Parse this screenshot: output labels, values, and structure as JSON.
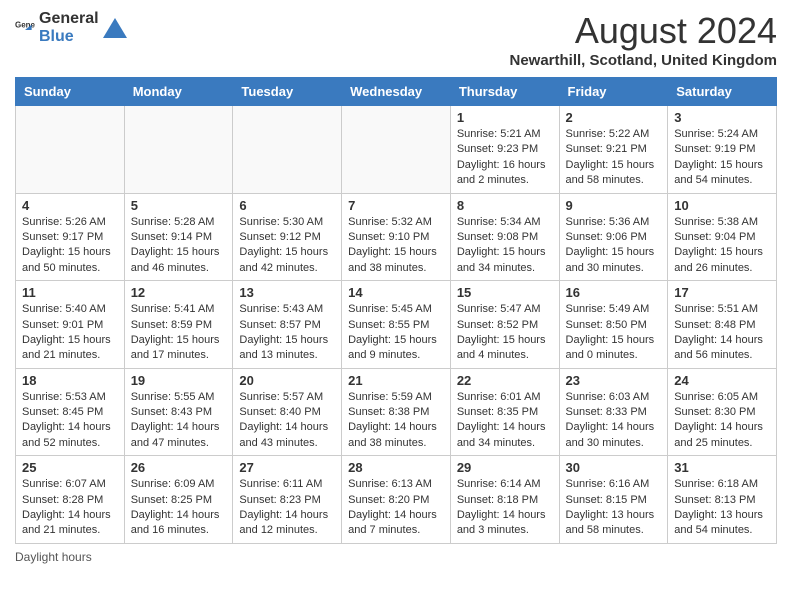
{
  "header": {
    "logo_general": "General",
    "logo_blue": "Blue",
    "title": "August 2024",
    "subtitle": "Newarthill, Scotland, United Kingdom"
  },
  "columns": [
    "Sunday",
    "Monday",
    "Tuesday",
    "Wednesday",
    "Thursday",
    "Friday",
    "Saturday"
  ],
  "weeks": [
    [
      {
        "day": "",
        "info": ""
      },
      {
        "day": "",
        "info": ""
      },
      {
        "day": "",
        "info": ""
      },
      {
        "day": "",
        "info": ""
      },
      {
        "day": "1",
        "info": "Sunrise: 5:21 AM\nSunset: 9:23 PM\nDaylight: 16 hours and 2 minutes."
      },
      {
        "day": "2",
        "info": "Sunrise: 5:22 AM\nSunset: 9:21 PM\nDaylight: 15 hours and 58 minutes."
      },
      {
        "day": "3",
        "info": "Sunrise: 5:24 AM\nSunset: 9:19 PM\nDaylight: 15 hours and 54 minutes."
      }
    ],
    [
      {
        "day": "4",
        "info": "Sunrise: 5:26 AM\nSunset: 9:17 PM\nDaylight: 15 hours and 50 minutes."
      },
      {
        "day": "5",
        "info": "Sunrise: 5:28 AM\nSunset: 9:14 PM\nDaylight: 15 hours and 46 minutes."
      },
      {
        "day": "6",
        "info": "Sunrise: 5:30 AM\nSunset: 9:12 PM\nDaylight: 15 hours and 42 minutes."
      },
      {
        "day": "7",
        "info": "Sunrise: 5:32 AM\nSunset: 9:10 PM\nDaylight: 15 hours and 38 minutes."
      },
      {
        "day": "8",
        "info": "Sunrise: 5:34 AM\nSunset: 9:08 PM\nDaylight: 15 hours and 34 minutes."
      },
      {
        "day": "9",
        "info": "Sunrise: 5:36 AM\nSunset: 9:06 PM\nDaylight: 15 hours and 30 minutes."
      },
      {
        "day": "10",
        "info": "Sunrise: 5:38 AM\nSunset: 9:04 PM\nDaylight: 15 hours and 26 minutes."
      }
    ],
    [
      {
        "day": "11",
        "info": "Sunrise: 5:40 AM\nSunset: 9:01 PM\nDaylight: 15 hours and 21 minutes."
      },
      {
        "day": "12",
        "info": "Sunrise: 5:41 AM\nSunset: 8:59 PM\nDaylight: 15 hours and 17 minutes."
      },
      {
        "day": "13",
        "info": "Sunrise: 5:43 AM\nSunset: 8:57 PM\nDaylight: 15 hours and 13 minutes."
      },
      {
        "day": "14",
        "info": "Sunrise: 5:45 AM\nSunset: 8:55 PM\nDaylight: 15 hours and 9 minutes."
      },
      {
        "day": "15",
        "info": "Sunrise: 5:47 AM\nSunset: 8:52 PM\nDaylight: 15 hours and 4 minutes."
      },
      {
        "day": "16",
        "info": "Sunrise: 5:49 AM\nSunset: 8:50 PM\nDaylight: 15 hours and 0 minutes."
      },
      {
        "day": "17",
        "info": "Sunrise: 5:51 AM\nSunset: 8:48 PM\nDaylight: 14 hours and 56 minutes."
      }
    ],
    [
      {
        "day": "18",
        "info": "Sunrise: 5:53 AM\nSunset: 8:45 PM\nDaylight: 14 hours and 52 minutes."
      },
      {
        "day": "19",
        "info": "Sunrise: 5:55 AM\nSunset: 8:43 PM\nDaylight: 14 hours and 47 minutes."
      },
      {
        "day": "20",
        "info": "Sunrise: 5:57 AM\nSunset: 8:40 PM\nDaylight: 14 hours and 43 minutes."
      },
      {
        "day": "21",
        "info": "Sunrise: 5:59 AM\nSunset: 8:38 PM\nDaylight: 14 hours and 38 minutes."
      },
      {
        "day": "22",
        "info": "Sunrise: 6:01 AM\nSunset: 8:35 PM\nDaylight: 14 hours and 34 minutes."
      },
      {
        "day": "23",
        "info": "Sunrise: 6:03 AM\nSunset: 8:33 PM\nDaylight: 14 hours and 30 minutes."
      },
      {
        "day": "24",
        "info": "Sunrise: 6:05 AM\nSunset: 8:30 PM\nDaylight: 14 hours and 25 minutes."
      }
    ],
    [
      {
        "day": "25",
        "info": "Sunrise: 6:07 AM\nSunset: 8:28 PM\nDaylight: 14 hours and 21 minutes."
      },
      {
        "day": "26",
        "info": "Sunrise: 6:09 AM\nSunset: 8:25 PM\nDaylight: 14 hours and 16 minutes."
      },
      {
        "day": "27",
        "info": "Sunrise: 6:11 AM\nSunset: 8:23 PM\nDaylight: 14 hours and 12 minutes."
      },
      {
        "day": "28",
        "info": "Sunrise: 6:13 AM\nSunset: 8:20 PM\nDaylight: 14 hours and 7 minutes."
      },
      {
        "day": "29",
        "info": "Sunrise: 6:14 AM\nSunset: 8:18 PM\nDaylight: 14 hours and 3 minutes."
      },
      {
        "day": "30",
        "info": "Sunrise: 6:16 AM\nSunset: 8:15 PM\nDaylight: 13 hours and 58 minutes."
      },
      {
        "day": "31",
        "info": "Sunrise: 6:18 AM\nSunset: 8:13 PM\nDaylight: 13 hours and 54 minutes."
      }
    ]
  ],
  "footer": {
    "note": "Daylight hours"
  }
}
